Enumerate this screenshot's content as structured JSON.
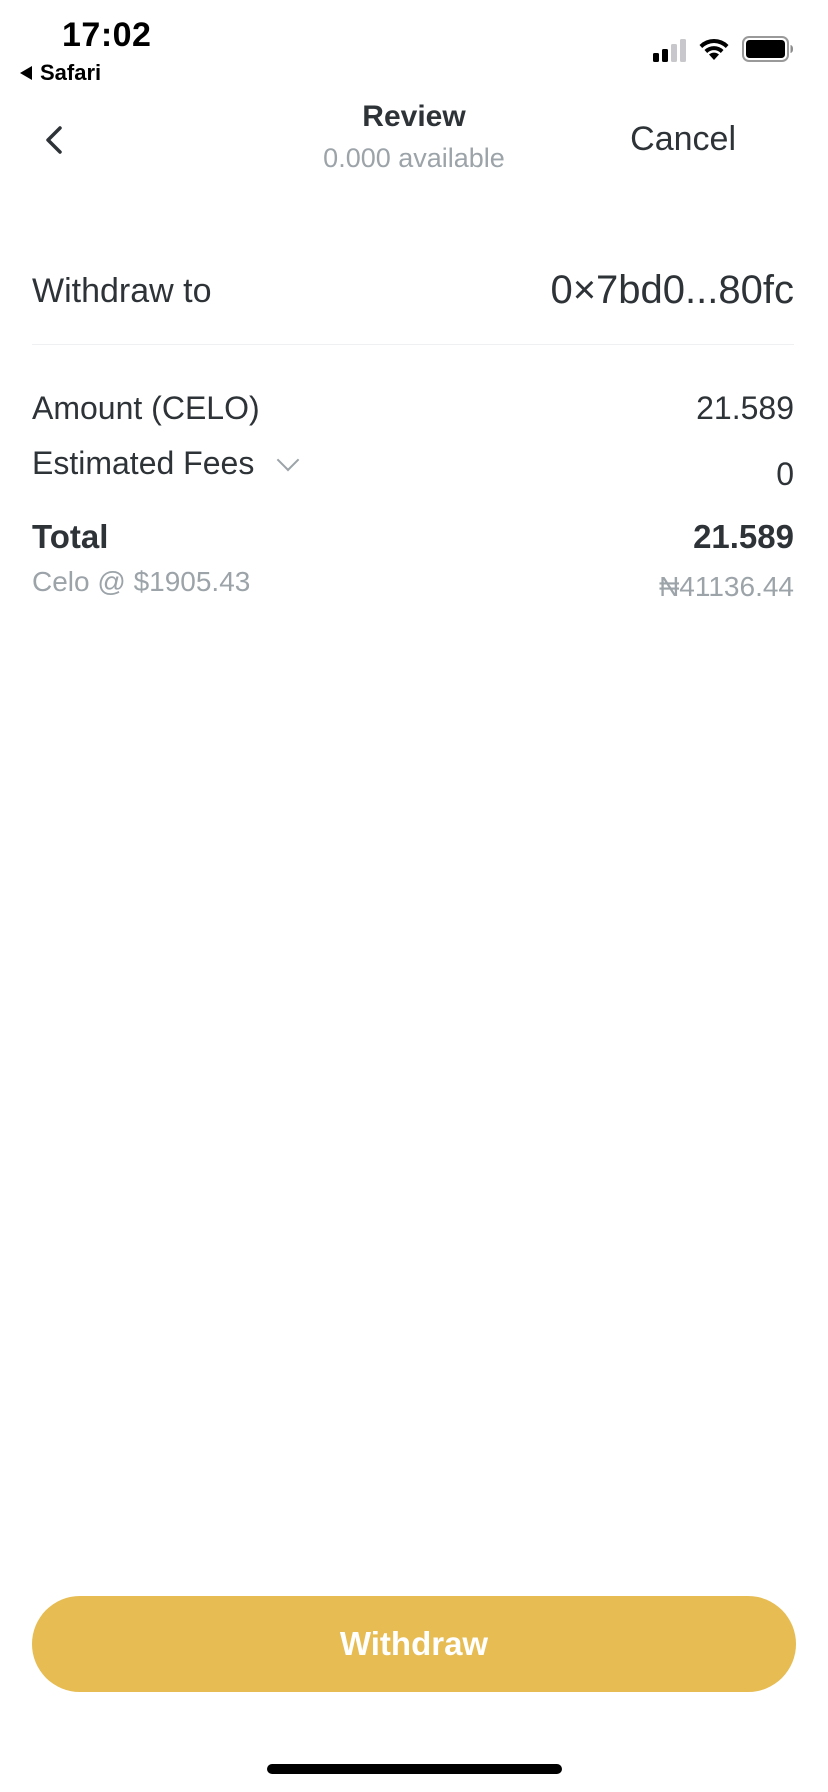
{
  "status_bar": {
    "time": "17:02",
    "back_app": "Safari"
  },
  "header": {
    "title": "Review",
    "subtitle": "0.000 available",
    "cancel_label": "Cancel"
  },
  "withdraw": {
    "label": "Withdraw to",
    "address": "0×7bd0...80fc"
  },
  "amount": {
    "label": "Amount (CELO)",
    "value": "21.589"
  },
  "fees": {
    "label": "Estimated Fees",
    "value": "0"
  },
  "total": {
    "label": "Total",
    "value": "21.589",
    "rate": "Celo @ $1905.43",
    "local_value": "₦41136.44"
  },
  "button": {
    "label": "Withdraw",
    "color": "#e6bc53"
  },
  "icons": [
    "back-arrow-icon",
    "chevron-down-icon",
    "signal-icon",
    "wifi-icon",
    "battery-icon"
  ]
}
